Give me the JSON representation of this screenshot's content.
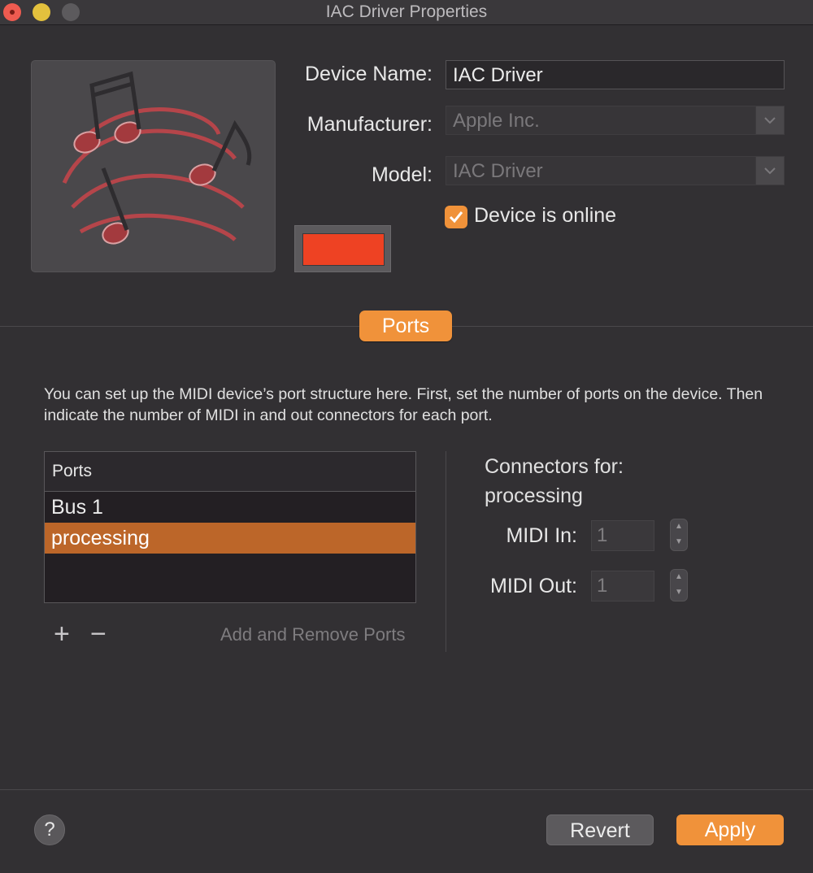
{
  "window": {
    "title": "IAC Driver Properties"
  },
  "device": {
    "name_label": "Device Name:",
    "name_value": "IAC Driver",
    "manufacturer_label": "Manufacturer:",
    "manufacturer_value": "Apple Inc.",
    "model_label": "Model:",
    "model_value": "IAC Driver",
    "online_label": "Device is online",
    "online_checked": true,
    "color": "#ee4223"
  },
  "tabs": {
    "ports_label": "Ports"
  },
  "ports": {
    "description": "You can set up the MIDI device’s port structure here. First, set the number of ports on the device. Then indicate the number of MIDI in and out connectors for each port.",
    "table_header": "Ports",
    "rows": [
      {
        "label": "Bus 1",
        "selected": false
      },
      {
        "label": "processing",
        "selected": true
      }
    ],
    "add_symbol": "+",
    "remove_symbol": "−",
    "add_remove_label": "Add and Remove Ports"
  },
  "connectors": {
    "title_line1": "Connectors for:",
    "title_line2": "processing",
    "midi_in_label": "MIDI In:",
    "midi_in_value": "1",
    "midi_out_label": "MIDI Out:",
    "midi_out_value": "1"
  },
  "footer": {
    "help_label": "?",
    "revert_label": "Revert",
    "apply_label": "Apply"
  },
  "colors": {
    "accent": "#f0923a",
    "selection": "#bc6629",
    "background": "#323033"
  }
}
